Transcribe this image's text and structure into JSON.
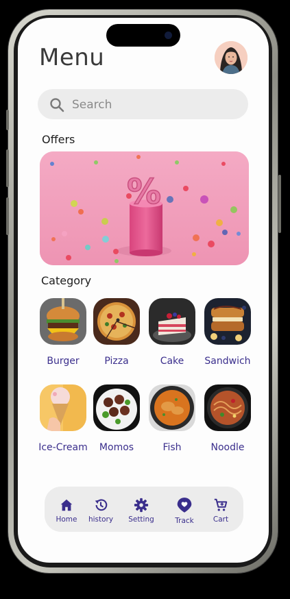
{
  "header": {
    "title": "Menu"
  },
  "search": {
    "placeholder": "Search"
  },
  "offers": {
    "label": "Offers"
  },
  "category": {
    "label": "Category",
    "items": [
      {
        "label": "Burger"
      },
      {
        "label": "Pizza"
      },
      {
        "label": "Cake"
      },
      {
        "label": "Sandwich"
      },
      {
        "label": "Ice-Cream"
      },
      {
        "label": "Momos"
      },
      {
        "label": "Fish"
      },
      {
        "label": "Noodle"
      }
    ]
  },
  "nav": {
    "items": [
      {
        "label": "Home",
        "icon": "home-icon"
      },
      {
        "label": "history",
        "icon": "history-icon"
      },
      {
        "label": "Setting",
        "icon": "gear-icon"
      },
      {
        "label": "Track",
        "icon": "location-pin-icon"
      },
      {
        "label": "Cart",
        "icon": "cart-icon"
      }
    ]
  },
  "colors": {
    "accent": "#3a2e8c",
    "banner": "#f3a7c2"
  }
}
